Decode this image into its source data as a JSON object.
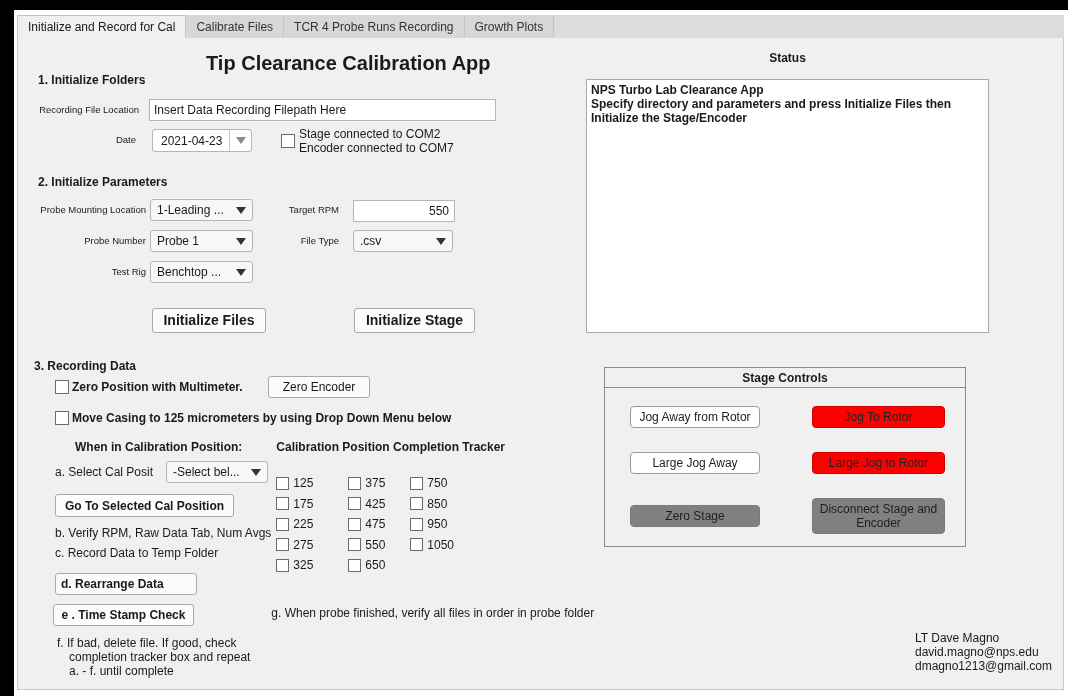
{
  "tabs": [
    {
      "label": "Initialize and Record for Cal",
      "selected": true
    },
    {
      "label": "Calibrate Files",
      "selected": false
    },
    {
      "label": "TCR 4 Probe Runs Recording",
      "selected": false
    },
    {
      "label": "Growth Plots",
      "selected": false
    }
  ],
  "title": "Tip Clearance Calibration App",
  "folders": {
    "heading": "1. Initialize Folders",
    "file_location": {
      "label": "Recording File Location",
      "value": "Insert Data Recording Filepath Here"
    },
    "date": {
      "label": "Date",
      "value": "2021-04-23"
    },
    "connection": {
      "checked": false,
      "lines": [
        "Stage connected to COM2",
        "Encoder connected to COM7"
      ]
    }
  },
  "parameters": {
    "heading": "2. Initialize Parameters",
    "left": [
      {
        "label": "Probe Mounting Location",
        "value": "1-Leading ..."
      },
      {
        "label": "Probe Number",
        "value": "Probe 1"
      },
      {
        "label": "Test Rig",
        "value": "Benchtop ..."
      }
    ],
    "right": [
      {
        "label": "Target RPM",
        "value": "550",
        "kind": "number"
      },
      {
        "label": "File Type",
        "value": ".csv",
        "kind": "dropdown"
      }
    ]
  },
  "init_buttons": [
    "Initialize Files",
    "Initialize Stage"
  ],
  "recording": {
    "heading": "3. Recording Data",
    "zero_check": {
      "label": "Zero Position with Multimeter.",
      "checked": false
    },
    "zero_button": "Zero Encoder",
    "move_check": {
      "label": "Move Casing to 125 micrometers by using Drop Down Menu below",
      "checked": false
    },
    "position_heading": "When in Calibration Position:",
    "select": {
      "label": "a. Select Cal Posit",
      "value": "-Select bel..."
    },
    "go_button": "Go To Selected Cal Position",
    "step_b": "b. Verify RPM, Raw Data Tab, Num Avgs",
    "step_c": "c. Record Data to Temp Folder",
    "rearrange_button": "d. Rearrange Data",
    "timestamp_button": "e . Time Stamp Check",
    "step_f": "f.  If bad, delete file. If good, check\ncompletion tracker box and repeat\na. - f. until complete",
    "tracker_heading": "Calibration Position Completion Tracker",
    "tracker": [
      [
        {
          "label": "125",
          "checked": false
        },
        {
          "label": "175",
          "checked": false
        },
        {
          "label": "225",
          "checked": false
        },
        {
          "label": "275",
          "checked": false
        },
        {
          "label": "325",
          "checked": false
        }
      ],
      [
        {
          "label": "375",
          "checked": false
        },
        {
          "label": "425",
          "checked": false
        },
        {
          "label": "475",
          "checked": false
        },
        {
          "label": "550",
          "checked": false
        },
        {
          "label": "650",
          "checked": false
        }
      ],
      [
        {
          "label": "750",
          "checked": false
        },
        {
          "label": "850",
          "checked": false
        },
        {
          "label": "950",
          "checked": false
        },
        {
          "label": "1050",
          "checked": false
        }
      ]
    ],
    "step_g": "g. When probe finished, verify all files in order in probe folder"
  },
  "status": {
    "title": "Status",
    "lines": [
      "NPS Turbo Lab Clearance App",
      "Specify directory and parameters and press Initialize Files then Initialize the Stage/Encoder"
    ]
  },
  "stage_controls": {
    "title": "Stage Controls",
    "buttons": [
      {
        "label": "Jog Away from Rotor",
        "color": "#ffffff"
      },
      {
        "label": "Jog To Rotor",
        "color": "#ff0000"
      },
      {
        "label": "Large Jog Away",
        "color": "#ffffff"
      },
      {
        "label": "Large Jog to Rotor",
        "color": "#ff0000"
      },
      {
        "label": "Zero Stage",
        "color": "#808080"
      },
      {
        "label": "Disconnect Stage and Encoder",
        "color": "#808080"
      }
    ]
  },
  "author": [
    "LT Dave Magno",
    "david.magno@nps.edu",
    "dmagno1213@gmail.com"
  ]
}
